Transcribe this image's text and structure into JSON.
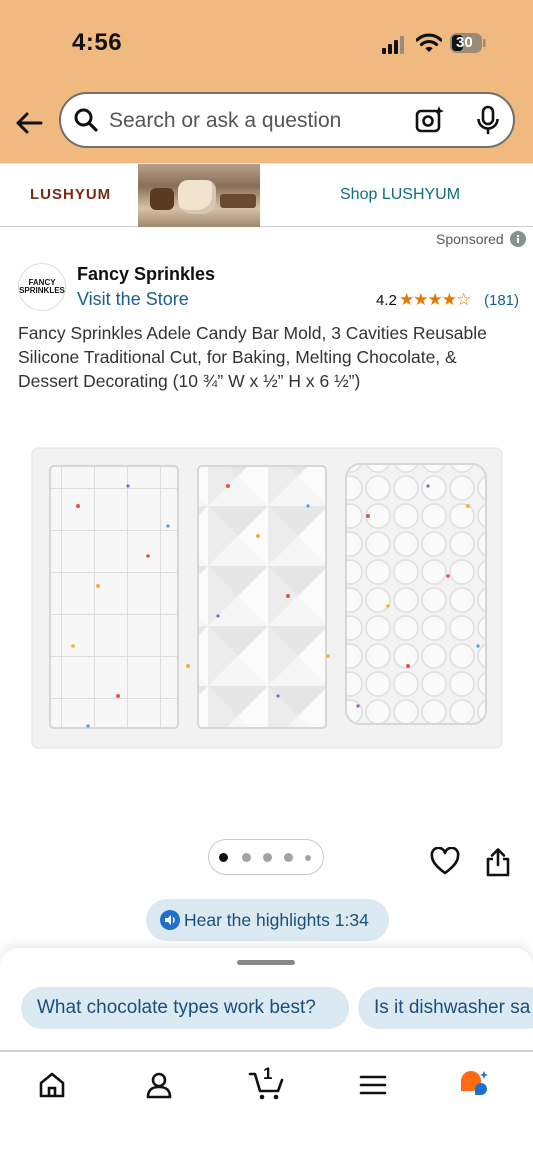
{
  "status_bar": {
    "time": "4:56",
    "battery": "30"
  },
  "search": {
    "placeholder": "Search or ask a question"
  },
  "ad": {
    "brand": "LUSHYUM",
    "cta": "Shop LUSHYUM"
  },
  "sponsored_label": "Sponsored",
  "seller": {
    "logo_text": "FANCY SPRINKLES",
    "name": "Fancy Sprinkles",
    "visit_store": "Visit the Store"
  },
  "rating": {
    "value": "4.2",
    "stars_display": "★★★★☆",
    "count": "(181)"
  },
  "product": {
    "title": "Fancy Sprinkles Adele Candy Bar Mold, 3 Cavities Reusable Silicone Traditional Cut, for Baking, Melting Chocolate, & Dessert Decorating (10 ¾” W x ½” H x 6 ½”)"
  },
  "audio": {
    "label": "Hear the highlights 1:34"
  },
  "suggestions": [
    "What chocolate types work best?",
    "Is it dishwasher sa"
  ],
  "bottom_nav": {
    "cart_count": "1"
  },
  "colors": {
    "header_bg": "#efb97f",
    "link": "#1a5d8c",
    "star": "#e77600",
    "chip_bg": "#dbe9f3",
    "rufus_orange": "#ff6a13",
    "rufus_blue": "#1f6fcf"
  }
}
